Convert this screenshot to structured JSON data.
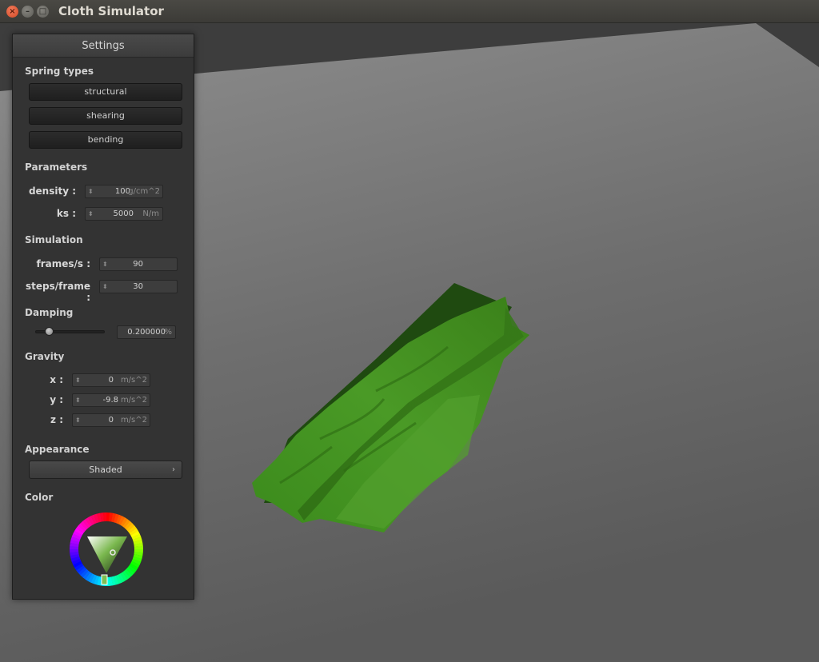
{
  "window": {
    "title": "Cloth Simulator"
  },
  "panel": {
    "title": "Settings",
    "spring_types": {
      "label": "Spring types",
      "buttons": [
        "structural",
        "shearing",
        "bending"
      ]
    },
    "parameters": {
      "label": "Parameters",
      "density": {
        "label": "density :",
        "value": "100",
        "unit": "g/cm^2"
      },
      "ks": {
        "label": "ks :",
        "value": "5000",
        "unit": "N/m"
      }
    },
    "simulation": {
      "label": "Simulation",
      "fps": {
        "label": "frames/s :",
        "value": "90"
      },
      "steps": {
        "label": "steps/frame :",
        "value": "30"
      }
    },
    "damping": {
      "label": "Damping",
      "value": "0.200000",
      "unit": "%",
      "slider_fraction": 0.2
    },
    "gravity": {
      "label": "Gravity",
      "x": {
        "label": "x :",
        "value": "0",
        "unit": "m/s^2"
      },
      "y": {
        "label": "y :",
        "value": "-9.8",
        "unit": "m/s^2"
      },
      "z": {
        "label": "z :",
        "value": "0",
        "unit": "m/s^2"
      }
    },
    "appearance": {
      "label": "Appearance",
      "selected": "Shaded"
    },
    "color": {
      "label": "Color",
      "value": "#3f8a20"
    }
  }
}
